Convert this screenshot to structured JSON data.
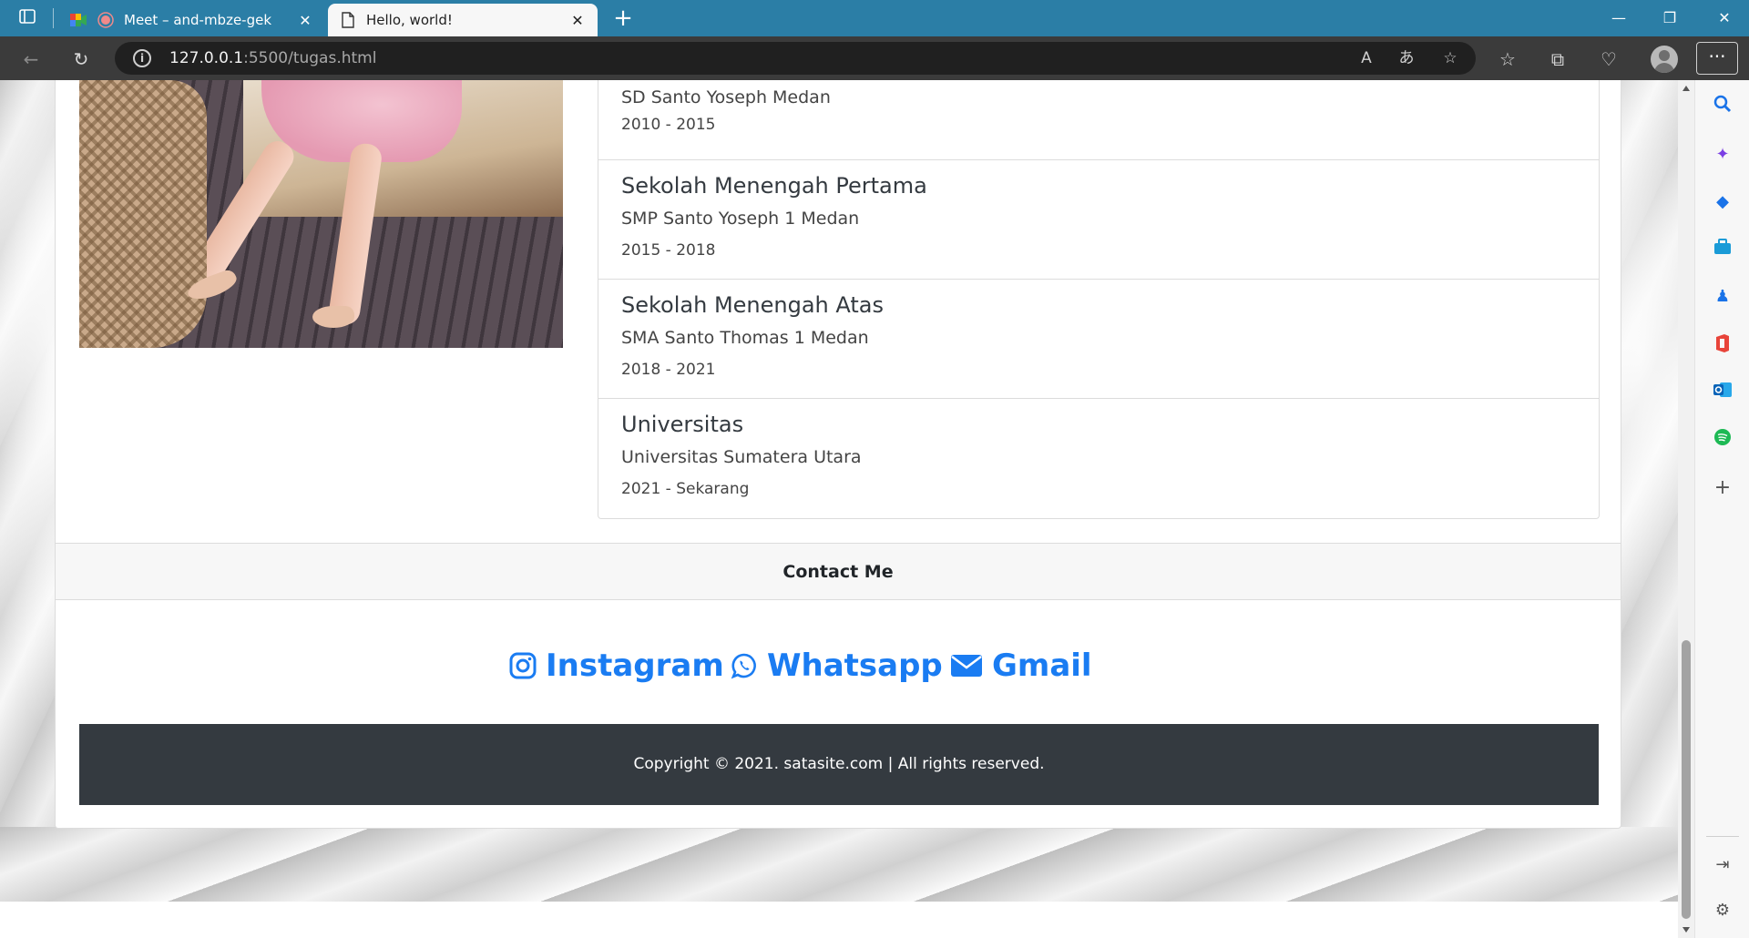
{
  "browser": {
    "tabs": [
      {
        "label": "Meet – and-mbze-gek",
        "active": false
      },
      {
        "label": "Hello, world!",
        "active": true
      }
    ],
    "address": {
      "host": "127.0.0.1",
      "path": ":5500/tugas.html"
    },
    "accent_color": "#2b7ea6"
  },
  "education": [
    {
      "title": "",
      "school": "SD Santo Yoseph Medan",
      "years": "2010 - 2015"
    },
    {
      "title": "Sekolah Menengah Pertama",
      "school": "SMP Santo Yoseph 1 Medan",
      "years": "2015 - 2018"
    },
    {
      "title": "Sekolah Menengah Atas",
      "school": "SMA Santo Thomas 1 Medan",
      "years": "2018 - 2021"
    },
    {
      "title": "Universitas",
      "school": "Universitas Sumatera Utara",
      "years": "2021 - Sekarang"
    }
  ],
  "contact": {
    "header": "Contact Me",
    "links": [
      {
        "label": "Instagram",
        "icon": "instagram-icon"
      },
      {
        "label": "Whatsapp",
        "icon": "whatsapp-icon"
      },
      {
        "label": "Gmail",
        "icon": "envelope-icon"
      }
    ],
    "link_color": "#1a7cf2"
  },
  "footer": {
    "text": "Copyright © 2021. satasite.com | All rights reserved."
  }
}
